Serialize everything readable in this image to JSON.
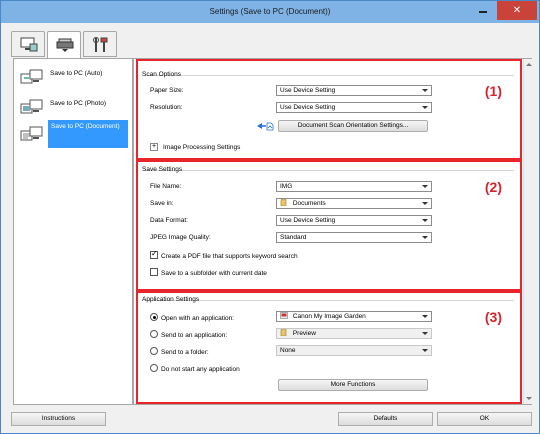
{
  "window": {
    "title": "Settings (Save to PC (Document))",
    "close_glyph": "✕"
  },
  "tabs": [
    {
      "name": "scan-from-computer-tab-icon"
    },
    {
      "name": "scan-from-panel-tab-icon"
    },
    {
      "name": "general-settings-tab-icon"
    }
  ],
  "sidebar": {
    "items": [
      {
        "label": "Save to PC (Auto)"
      },
      {
        "label": "Save to PC (Photo)"
      },
      {
        "label": "Save to PC (Document)",
        "selected": true
      }
    ]
  },
  "scan_options": {
    "title": "Scan Options",
    "number": "(1)",
    "paper_size_label": "Paper Size:",
    "paper_size_value": "Use Device Setting",
    "resolution_label": "Resolution:",
    "resolution_value": "Use Device Setting",
    "orientation_button": "Document Scan Orientation Settings...",
    "image_processing_toggle": "+",
    "image_processing_label": "Image Processing Settings"
  },
  "save_settings": {
    "title": "Save Settings",
    "number": "(2)",
    "file_name_label": "File Name:",
    "file_name_value": "IMG",
    "save_in_label": "Save in:",
    "save_in_value": "Documents",
    "data_format_label": "Data Format:",
    "data_format_value": "Use Device Setting",
    "jpeg_quality_label": "JPEG Image Quality:",
    "jpeg_quality_value": "Standard",
    "pdf_keyword_label": "Create a PDF file that supports keyword search",
    "pdf_keyword_checked": true,
    "subfolder_label": "Save to a subfolder with current date",
    "subfolder_checked": false
  },
  "application_settings": {
    "title": "Application Settings",
    "number": "(3)",
    "open_app_label": "Open with an application:",
    "open_app_value": "Canon My Image Garden",
    "send_app_label": "Send to an application:",
    "send_app_value": "Preview",
    "send_folder_label": "Send to a folder:",
    "send_folder_value": "None",
    "no_app_label": "Do not start any application",
    "more_functions_button": "More Functions",
    "selected_option": "open_app"
  },
  "footer": {
    "instructions_button": "Instructions",
    "defaults_button": "Defaults",
    "ok_button": "OK"
  }
}
